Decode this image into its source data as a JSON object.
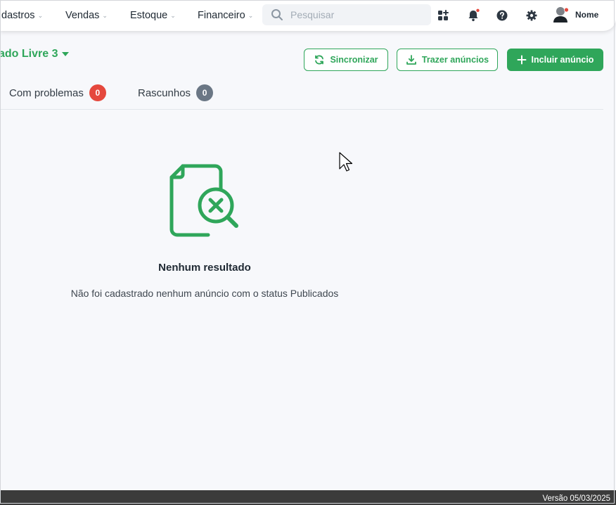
{
  "nav": {
    "items": [
      {
        "label": "dastros"
      },
      {
        "label": "Vendas"
      },
      {
        "label": "Estoque"
      },
      {
        "label": "Financeiro"
      }
    ],
    "chevron": "⌄"
  },
  "search": {
    "placeholder": "Pesquisar",
    "value": ""
  },
  "topbar_icons": [
    "apps-icon",
    "notification-bell-icon",
    "help-icon",
    "settings-icon"
  ],
  "user": {
    "name": "Nome"
  },
  "page": {
    "channel_title": "ado Livre 3",
    "buttons": {
      "sync": "Sincronizar",
      "import": "Trazer anúncios",
      "add": "Incluir anúncio"
    },
    "tabs": [
      {
        "label": "Com problemas",
        "count": "0",
        "badge_color": "#e5483d"
      },
      {
        "label": "Rascunhos",
        "count": "0",
        "badge_color": "#6b7785"
      }
    ]
  },
  "empty_state": {
    "icon": "document-search-x-icon",
    "title": "Nenhum resultado",
    "message": "Não foi cadastrado nenhum anúncio com o status Publicados"
  },
  "footer": {
    "version": "Versão 05/03/2025"
  },
  "colors": {
    "accent": "#2fa65a",
    "background": "#f7f8fb",
    "footer": "#3b3b3b"
  }
}
